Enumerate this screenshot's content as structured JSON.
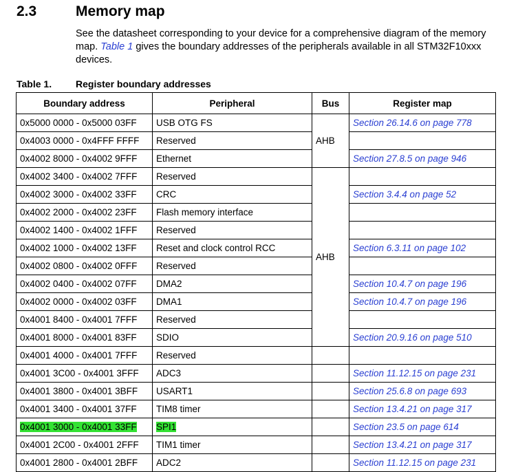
{
  "section": {
    "number": "2.3",
    "title": "Memory map",
    "intro_before": "See the datasheet corresponding to your device for a comprehensive diagram of the memory map. ",
    "intro_link": "Table 1",
    "intro_after": " gives the boundary addresses of the peripherals available in all STM32F10xxx devices."
  },
  "table": {
    "caption_number": "Table 1.",
    "caption_title": "Register boundary addresses",
    "headers": [
      "Boundary address",
      "Peripheral",
      "Bus",
      "Register map"
    ],
    "bus_groups": [
      "AHB",
      "AHB"
    ],
    "highlight_color": "#33e233",
    "rows": [
      {
        "address": "0x5000 0000 - 0x5000 03FF",
        "peripheral": "USB OTG FS",
        "register_map": "Section 26.14.6 on page 778"
      },
      {
        "address": "0x4003 0000 - 0x4FFF FFFF",
        "peripheral": "Reserved",
        "register_map": ""
      },
      {
        "address": "0x4002 8000 - 0x4002 9FFF",
        "peripheral": "Ethernet",
        "register_map": "Section 27.8.5 on page 946"
      },
      {
        "address": "0x4002 3400 - 0x4002 7FFF",
        "peripheral": "Reserved",
        "register_map": ""
      },
      {
        "address": "0x4002 3000 - 0x4002 33FF",
        "peripheral": "CRC",
        "register_map": "Section 3.4.4 on page 52"
      },
      {
        "address": "0x4002 2000 - 0x4002 23FF",
        "peripheral": "Flash memory interface",
        "register_map": ""
      },
      {
        "address": "0x4002 1400 - 0x4002 1FFF",
        "peripheral": "Reserved",
        "register_map": ""
      },
      {
        "address": "0x4002 1000 - 0x4002 13FF",
        "peripheral": "Reset and clock control RCC",
        "register_map": "Section 6.3.11 on page 102"
      },
      {
        "address": "0x4002 0800 - 0x4002 0FFF",
        "peripheral": "Reserved",
        "register_map": ""
      },
      {
        "address": "0x4002 0400 - 0x4002 07FF",
        "peripheral": "DMA2",
        "register_map": "Section 10.4.7 on page 196"
      },
      {
        "address": "0x4002 0000 - 0x4002 03FF",
        "peripheral": "DMA1",
        "register_map": "Section 10.4.7 on page 196"
      },
      {
        "address": "0x4001 8400 - 0x4001 7FFF",
        "peripheral": "Reserved",
        "register_map": ""
      },
      {
        "address": "0x4001 8000 - 0x4001 83FF",
        "peripheral": "SDIO",
        "register_map": "Section 20.9.16 on page 510"
      },
      {
        "address": "0x4001 4000 - 0x4001 7FFF",
        "peripheral": "Reserved",
        "register_map": ""
      },
      {
        "address": "0x4001 3C00 - 0x4001 3FFF",
        "peripheral": "ADC3",
        "register_map": "Section 11.12.15 on page 231"
      },
      {
        "address": "0x4001 3800 - 0x4001 3BFF",
        "peripheral": "USART1",
        "register_map": "Section 25.6.8 on page 693"
      },
      {
        "address": "0x4001 3400 - 0x4001 37FF",
        "peripheral": "TIM8 timer",
        "register_map": "Section 13.4.21 on page 317"
      },
      {
        "address": "0x4001 3000 - 0x4001 33FF",
        "peripheral": "SPI1",
        "register_map": "Section 23.5 on page 614"
      },
      {
        "address": "0x4001 2C00 - 0x4001 2FFF",
        "peripheral": "TIM1 timer",
        "register_map": "Section 13.4.21 on page 317"
      },
      {
        "address": "0x4001 2800 - 0x4001 2BFF",
        "peripheral": "ADC2",
        "register_map": "Section 11.12.15 on page 231"
      }
    ]
  }
}
